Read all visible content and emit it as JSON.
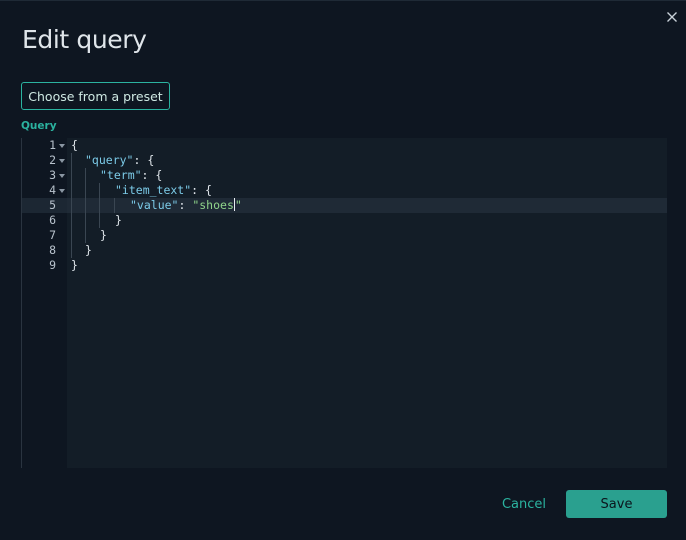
{
  "modal": {
    "title": "Edit query",
    "close_icon": "close-icon"
  },
  "preset": {
    "label": "Choose from a preset"
  },
  "editor": {
    "label": "Query",
    "active_line": 5,
    "line_numbers": [
      "1",
      "2",
      "3",
      "4",
      "5",
      "6",
      "7",
      "8",
      "9"
    ],
    "lines": [
      {
        "key": "",
        "text": "{"
      },
      {
        "key": "\"query\"",
        "text": ": {"
      },
      {
        "key": "\"term\"",
        "text": ": {"
      },
      {
        "key": "\"item_text\"",
        "text": ": {"
      },
      {
        "key": "\"value\"",
        "text": ": ",
        "string": "\"shoes",
        "string_end": "\""
      },
      {
        "key": "",
        "text": "}"
      },
      {
        "key": "",
        "text": "}"
      },
      {
        "key": "",
        "text": "}"
      },
      {
        "key": "",
        "text": "}"
      }
    ]
  },
  "actions": {
    "cancel_label": "Cancel",
    "save_label": "Save"
  },
  "colors": {
    "accent": "#2bb3a0",
    "background": "#0e1621",
    "editor_bg": "#131d27",
    "key": "#7ccbe8",
    "string": "#8fd48a"
  }
}
